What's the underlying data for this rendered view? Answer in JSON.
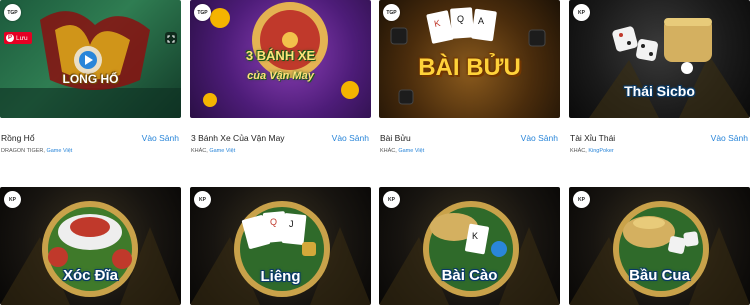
{
  "games": [
    {
      "name": "Rồng Hổ",
      "play_label": "Vào Sảnh",
      "category": "DRAGON TIGER, ",
      "provider": "Game Việt",
      "badge": "TGP",
      "art_title": "LONG HỔ"
    },
    {
      "name": "3 Bánh Xe Của Vận May",
      "play_label": "Vào Sảnh",
      "category": "KHÁC, ",
      "provider": "Game Việt",
      "badge": "TGP",
      "art_title": "3 BÁNH XE",
      "art_subtitle": "của Vận May"
    },
    {
      "name": "Bài Bửu",
      "play_label": "Vào Sảnh",
      "category": "KHÁC, ",
      "provider": "Game Việt",
      "badge": "TGP",
      "art_title": "BÀI BỬU"
    },
    {
      "name": "Tài Xỉu Thái",
      "play_label": "Vào Sảnh",
      "category": "KHÁC, ",
      "provider": "KingPoker",
      "badge": "KP",
      "art_title": "Thái Sicbo"
    },
    {
      "badge": "KP",
      "art_title": "Xóc Đĩa"
    },
    {
      "badge": "KP",
      "art_title": "Liêng"
    },
    {
      "badge": "KP",
      "art_title": "Bài Cào"
    },
    {
      "badge": "KP",
      "art_title": "Bầu Cua"
    }
  ],
  "pinterest": {
    "label": "Lưu"
  },
  "colors": {
    "link": "#2a86d9",
    "pinterest": "#e60023"
  }
}
